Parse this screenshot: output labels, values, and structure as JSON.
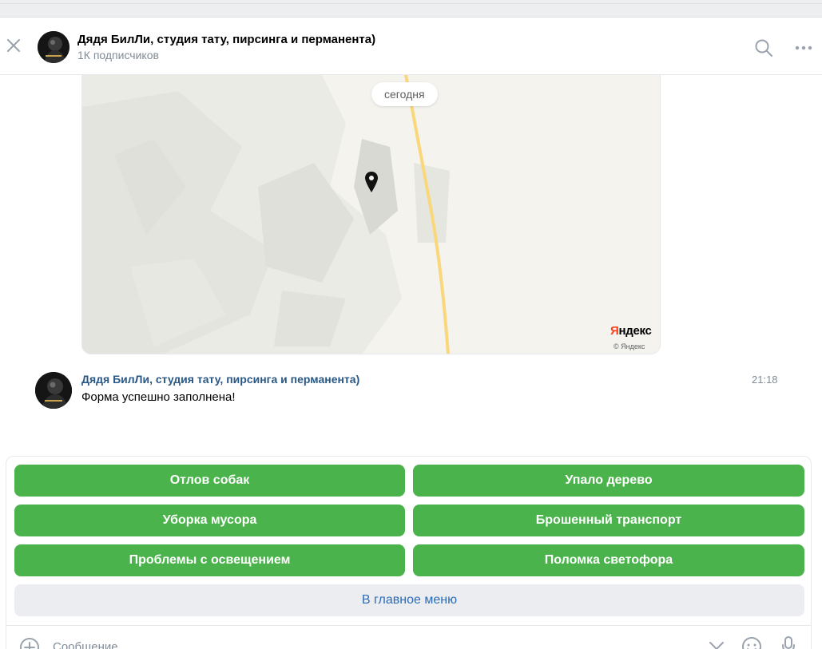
{
  "colors": {
    "accent_green": "#4bb34b",
    "link_blue": "#2a5885",
    "menu_blue": "#2d6cb7",
    "secondary_text": "#818c99",
    "map_road": "#f9d77a"
  },
  "header": {
    "title": "Дядя БилЛи, студия тату, пирсинга и перманента)",
    "subtitle": "1К подписчиков",
    "icons": [
      "close-icon",
      "avatar",
      "search-icon",
      "more-icon"
    ]
  },
  "map": {
    "date_label": "сегодня",
    "logo_first_letter": "Я",
    "logo_rest": "ндекс",
    "copyright": "© Яндекс",
    "icons": [
      "map-pin-icon"
    ]
  },
  "message": {
    "author": "Дядя БилЛи, студия тату, пирсинга и перманента)",
    "time": "21:18",
    "text": "Форма успешно заполнена!"
  },
  "keyboard": {
    "buttons": [
      {
        "label": "Отлов собак",
        "color": "green"
      },
      {
        "label": "Упало дерево",
        "color": "green"
      },
      {
        "label": "Уборка мусора",
        "color": "green"
      },
      {
        "label": "Брошенный транспорт",
        "color": "green"
      },
      {
        "label": "Проблемы с освещением",
        "color": "green"
      },
      {
        "label": "Поломка светофора",
        "color": "green"
      },
      {
        "label": "В главное меню",
        "color": "grey"
      }
    ]
  },
  "composer": {
    "placeholder": "Сообщение",
    "icons": [
      "plus-circle-icon",
      "chevron-down-icon",
      "smile-icon",
      "microphone-icon"
    ]
  }
}
